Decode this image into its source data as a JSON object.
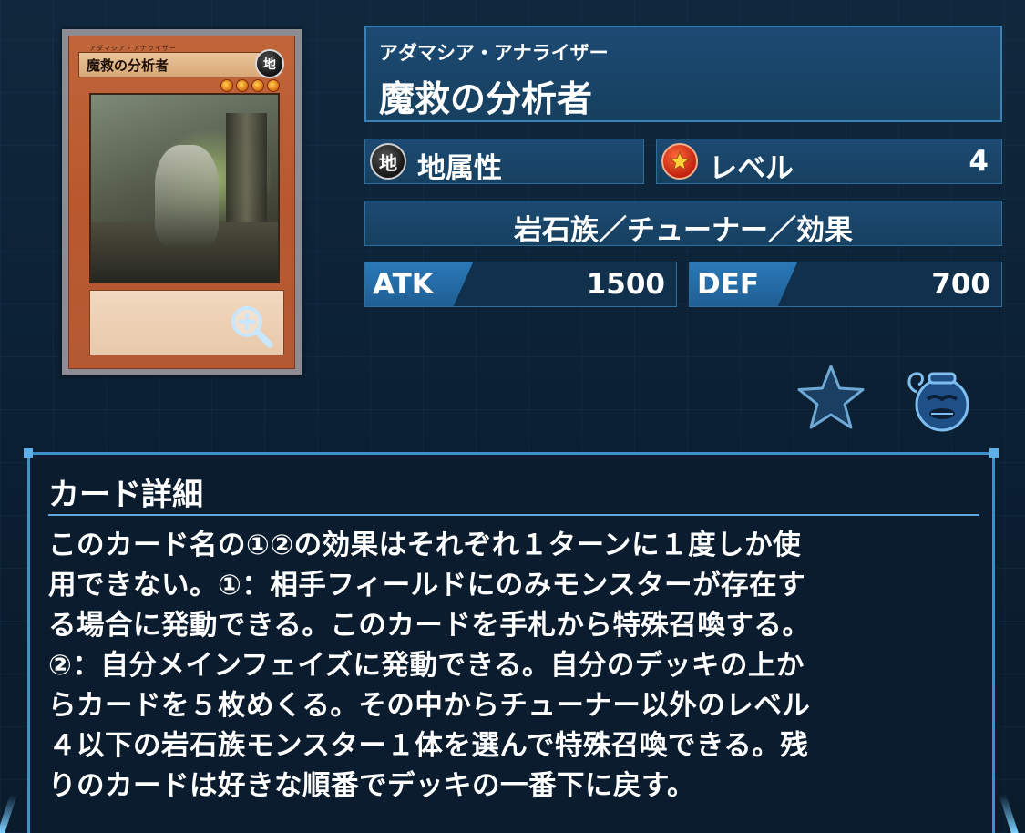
{
  "card_image": {
    "ruby": "アダマシア・アナライザー",
    "name": "魔救の分析者",
    "attribute_glyph": "地",
    "level_stars": 4,
    "zoom_icon": "magnifier-plus-icon"
  },
  "card": {
    "ruby": "アダマシア・アナライザー",
    "name": "魔救の分析者",
    "attribute_icon_glyph": "地",
    "attribute_label": "地属性",
    "level_label": "レベル",
    "level_value": "4",
    "type_line": "岩石族／チューナー／効果",
    "atk_label": "ATK",
    "atk_value": "1500",
    "def_label": "DEF",
    "def_value": "700"
  },
  "actions": {
    "favorite_icon": "star-icon",
    "deck_icon": "pot-of-greed-icon"
  },
  "detail": {
    "title": "カード詳細",
    "text": "このカード名の①②の効果はそれぞれ１ターンに１度しか使\n用できない。①：相手フィールドにのみモンスターが存在す\nる場合に発動できる。このカードを手札から特殊召喚する。\n②：自分メインフェイズに発動できる。自分のデッキの上か\nらカードを５枚めくる。その中からチューナー以外のレベル\n４以下の岩石族モンスター１体を選んで特殊召喚できる。残\nりのカードは好きな順番でデッキの一番下に戻す。"
  },
  "colors": {
    "background": "#0d2236",
    "panel": "#1c4a73",
    "panel_border": "#2f6f9c",
    "stat_tag": "#2a79b8",
    "accent_line": "#5fa7dd",
    "card_frame": "#b9582f"
  }
}
